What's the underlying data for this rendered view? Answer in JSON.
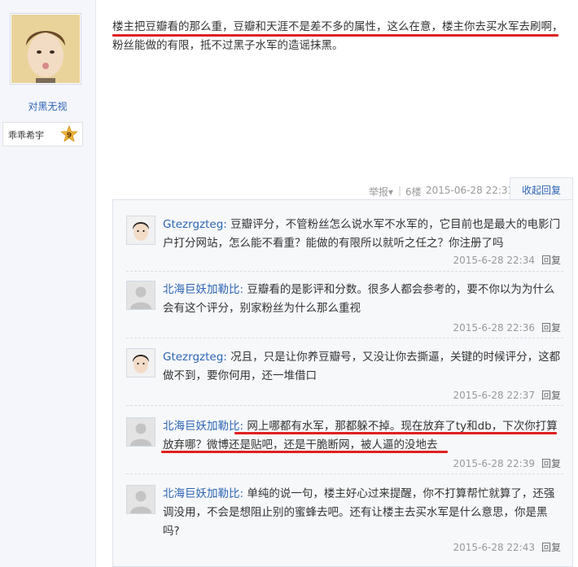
{
  "author": {
    "name": "对黑无视",
    "honor_title": "乖乖希宇",
    "level": "9"
  },
  "post": {
    "text": "楼主把豆瓣看的那么重，豆瓣和天涯不是差不多的属性，这么在意，楼主你去买水军去刷啊，粉丝能做的有限，抵不过黑子水军的造谣抹黑。"
  },
  "post_meta": {
    "report": "举报▾",
    "floor": "6楼",
    "datetime": "2015-06-28 22:31",
    "collapse": "收起回复"
  },
  "replies": [
    {
      "user": "Gtezrgzteg:",
      "text": " 豆瓣评分，不管粉丝怎么说水军不水军的，它目前也是最大的电影门户打分网站，怎么能不看重？能做的有限所以就听之任之？你注册了吗",
      "time": "2015-6-28 22:34",
      "reply": "回复"
    },
    {
      "user": "北海巨妖加勒比:",
      "text": " 豆瓣看的是影评和分数。很多人都会参考的，要不你以为为什么会有这个评分，别家粉丝为什么那么重视",
      "time": "2015-6-28 22:36",
      "reply": "回复"
    },
    {
      "user": "Gtezrgzteg:",
      "text": " 况且，只是让你养豆瓣号，又没让你去撕逼，关键的时候评分，这都做不到，要你何用，还一堆借口",
      "time": "2015-6-28 22:37",
      "reply": "回复"
    },
    {
      "user": "北海巨妖加勒比:",
      "text": " 网上哪都有水军，那都躲不掉。现在放弃了ty和db，下次你打算放弃哪？微博还是贴吧，还是干脆断网，被人逼的没地去",
      "time": "2015-6-28 22:39",
      "reply": "回复"
    },
    {
      "user": "北海巨妖加勒比:",
      "text": " 单纯的说一句，楼主好心过来提醒，你不打算帮忙就算了，还强调没用，不会是想阻止别的蜜蜂去吧。还有让楼主去买水军是什么意思，你是黑吗?",
      "time": "2015-6-28 22:43",
      "reply": "回复"
    }
  ],
  "colors": {
    "link_blue": "#2d64b3",
    "underline_red": "#e02020",
    "sidebar_bg": "#f4f6fb",
    "reply_bg": "#f7f8fa"
  },
  "icons": {
    "avatar_default": "person-silhouette-icon",
    "level_badge": "star-badge-icon"
  }
}
